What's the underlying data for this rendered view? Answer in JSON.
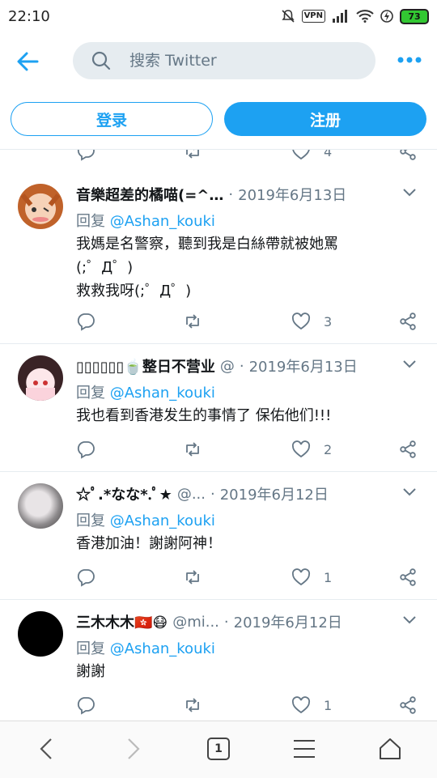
{
  "status_bar": {
    "time": "22:10",
    "vpn": "VPN",
    "battery": "73"
  },
  "header": {
    "search_placeholder": "搜索 Twitter"
  },
  "auth": {
    "login_label": "登录",
    "signup_label": "注册"
  },
  "partial_tweet": {
    "like_count": "4"
  },
  "tweets": [
    {
      "name": "音樂超差的橘喵(=^…",
      "handle": "",
      "date": "2019年6月13日",
      "reply_prefix": "回复",
      "mention": "@Ashan_kouki",
      "text": "我媽是名警察，聽到我是白絲帶就被她罵\n(;゜Д゜)\n救救我呀(;゜Д゜)",
      "like_count": "3"
    },
    {
      "name": "▯▯▯▯▯▯🍵整日不营业",
      "handle": "@",
      "date": "2019年6月13日",
      "reply_prefix": "回复",
      "mention": "@Ashan_kouki",
      "text": "我也看到香港发生的事情了 保佑他们!!!",
      "like_count": "2"
    },
    {
      "name": "☆ﾟ.*なな*.ﾟ★",
      "handle": "@...",
      "date": "2019年6月12日",
      "reply_prefix": "回复",
      "mention": "@Ashan_kouki",
      "text": "香港加油！謝謝阿神！",
      "like_count": "1"
    },
    {
      "name": "三木木木🇭🇰😷",
      "handle": "@mi...",
      "date": "2019年6月12日",
      "reply_prefix": "回复",
      "mention": "@Ashan_kouki",
      "text": "謝謝",
      "like_count": "1"
    }
  ],
  "bottom_nav": {
    "tab_count": "1"
  },
  "colors": {
    "accent": "#1da1f2",
    "muted": "#657786",
    "divider": "#e6ecf0"
  }
}
